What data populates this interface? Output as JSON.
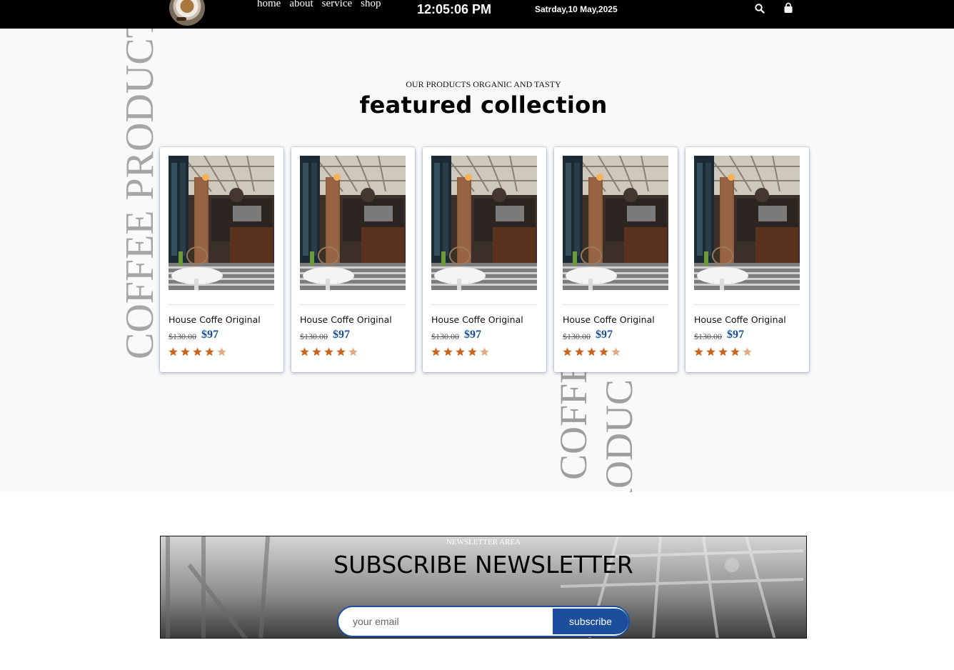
{
  "header": {
    "logo": "coffee-cup-logo",
    "nav": [
      "home",
      "about",
      "service",
      "shop"
    ],
    "time": "12:05:06 PM",
    "date": "Satrday,10 May,2025",
    "icons": [
      "search-icon",
      "shopping-bag-icon"
    ]
  },
  "products": {
    "watermark": "COFFEE PRODUCTS",
    "watermark_lower_1": "COFFE",
    "watermark_lower_2": "RODUC",
    "eyebrow": "OUR PRODUCTS ORGANIC AND TASTY",
    "title": "featured collection",
    "items": [
      {
        "name": "House Coffe Original",
        "old_price": "$130.00",
        "price": "$97",
        "rating": 4.5
      },
      {
        "name": "House Coffe Original",
        "old_price": "$130.00",
        "price": "$97",
        "rating": 4.5
      },
      {
        "name": "House Coffe Original",
        "old_price": "$130.00",
        "price": "$97",
        "rating": 4.5
      },
      {
        "name": "House Coffe Original",
        "old_price": "$130.00",
        "price": "$97",
        "rating": 4.5
      },
      {
        "name": "House Coffe Original",
        "old_price": "$130.00",
        "price": "$97",
        "rating": 4.5
      }
    ],
    "star_color": "#c8641c"
  },
  "newsletter": {
    "eyebrow": "NEWSLETTER AREA",
    "title": "SUBSCRIBE NEWSLETTER",
    "placeholder": "your email",
    "button": "subscribe",
    "accent": "#1b4f9e"
  }
}
